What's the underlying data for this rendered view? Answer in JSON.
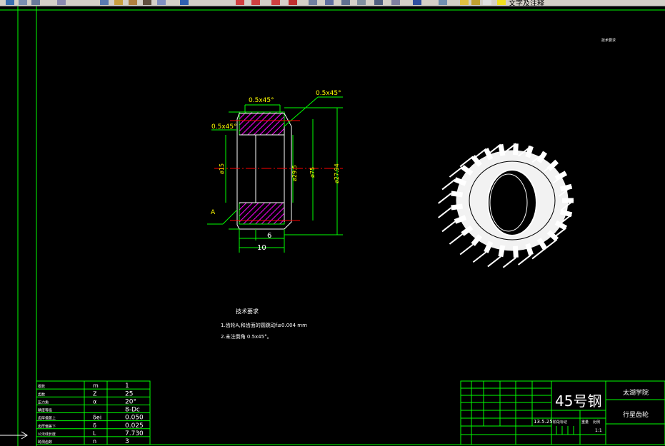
{
  "toolbar": {
    "layer_label": "文字及注释"
  },
  "drawing": {
    "corner_note": "技术要求",
    "dims": {
      "chamfer_top": "0.5x45°",
      "chamfer_right": "0.5x45°",
      "chamfer_left": "0.5x45°",
      "dia_bore": "ø15",
      "dia_hub": "ø29.5",
      "dia_root": "ø75",
      "dia_outer": "ø27.94",
      "width_inner": "6",
      "width_total": "10",
      "datum": "A"
    },
    "tech": {
      "title": "技术要求",
      "line1": "1.齿轮A,和齿面的圆跳动f≤0.004 mm",
      "line2": "2.未注倒角 0.5x45°。"
    }
  },
  "param_table": {
    "rows": [
      {
        "name": "模数",
        "sym": "m",
        "val": "1"
      },
      {
        "name": "齿数",
        "sym": "Z",
        "val": "25"
      },
      {
        "name": "压力角",
        "sym": "α",
        "val": "20°"
      },
      {
        "name": "精度等级",
        "sym": "",
        "val": "8-Dc"
      },
      {
        "name": "齿厚偏差上",
        "sym": "δei",
        "val": "0.050"
      },
      {
        "name": "齿厚偏差下",
        "sym": "δ",
        "val": "0.025"
      },
      {
        "name": "公法线长度",
        "sym": "L",
        "val": "7.730"
      },
      {
        "name": "跨测齿数",
        "sym": "n",
        "val": "3"
      }
    ]
  },
  "title_block": {
    "material": "45号钢",
    "school": "太湖学院",
    "part_name": "行星齿轮",
    "date": "13.5.25",
    "scale": "1:1",
    "label_stage": "阶段标记",
    "label_weight": "重量",
    "label_ratio": "比例"
  }
}
